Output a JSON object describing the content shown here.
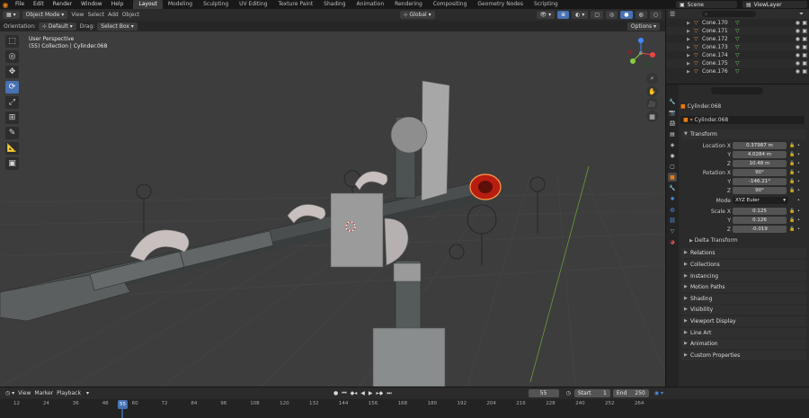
{
  "top_menu": [
    "File",
    "Edit",
    "Render",
    "Window",
    "Help"
  ],
  "workspaces": [
    "Layout",
    "Modeling",
    "Sculpting",
    "UV Editing",
    "Texture Paint",
    "Shading",
    "Animation",
    "Rendering",
    "Compositing",
    "Geometry Nodes",
    "Scripting"
  ],
  "active_workspace": "Layout",
  "scene": "Scene",
  "view_layer": "ViewLayer",
  "viewport_header": {
    "mode": "Object Mode",
    "menus": [
      "View",
      "Select",
      "Add",
      "Object"
    ],
    "orientation_label": "Orientation:",
    "orientation_value": "Default",
    "drag_label": "Drag:",
    "drag_value": "Select Box",
    "transform_orientation": "Global",
    "options": "Options"
  },
  "viewport": {
    "perspective": "User Perspective",
    "collection_info": "(55) Collection | Cylinder.068"
  },
  "outliner": {
    "search_placeholder": "",
    "rows": [
      "Cone.170",
      "Cone.171",
      "Cone.172",
      "Cone.173",
      "Cone.174",
      "Cone.175",
      "Cone.176"
    ]
  },
  "properties": {
    "object_name": "Cylinder.068",
    "data_name": "Cylinder.068",
    "transform_label": "Transform",
    "location_label": "Location X",
    "location": [
      "0.37987 m",
      "4.0284 m",
      "10.48 m"
    ],
    "rotation_label": "Rotation X",
    "rotation": [
      "90°",
      "-146.21°",
      "90°"
    ],
    "mode_label": "Mode",
    "mode_value": "XYZ Euler",
    "scale_label": "Scale X",
    "scale": [
      "0.125",
      "0.126",
      "-0.019"
    ],
    "axis_y": "Y",
    "axis_z": "Z",
    "delta_transform": "Delta Transform",
    "panels": [
      "Relations",
      "Collections",
      "Instancing",
      "Motion Paths",
      "Shading",
      "Visibility",
      "Viewport Display",
      "Line Art",
      "Animation",
      "Custom Properties"
    ]
  },
  "timeline": {
    "menus": [
      "View",
      "Marker",
      "Playback"
    ],
    "current_frame": "55",
    "start_label": "Start",
    "start": "1",
    "end_label": "End",
    "end": "250",
    "ticks": [
      "12",
      "24",
      "36",
      "48",
      "60",
      "72",
      "84",
      "96",
      "108",
      "120",
      "132",
      "144",
      "156",
      "168",
      "180",
      "192",
      "204",
      "216",
      "228",
      "240",
      "252",
      "264"
    ],
    "marker": "55"
  },
  "colors": {
    "accent": "#4772b3",
    "object_orange": "#e87d0d",
    "selected_red": "#d02a10"
  }
}
